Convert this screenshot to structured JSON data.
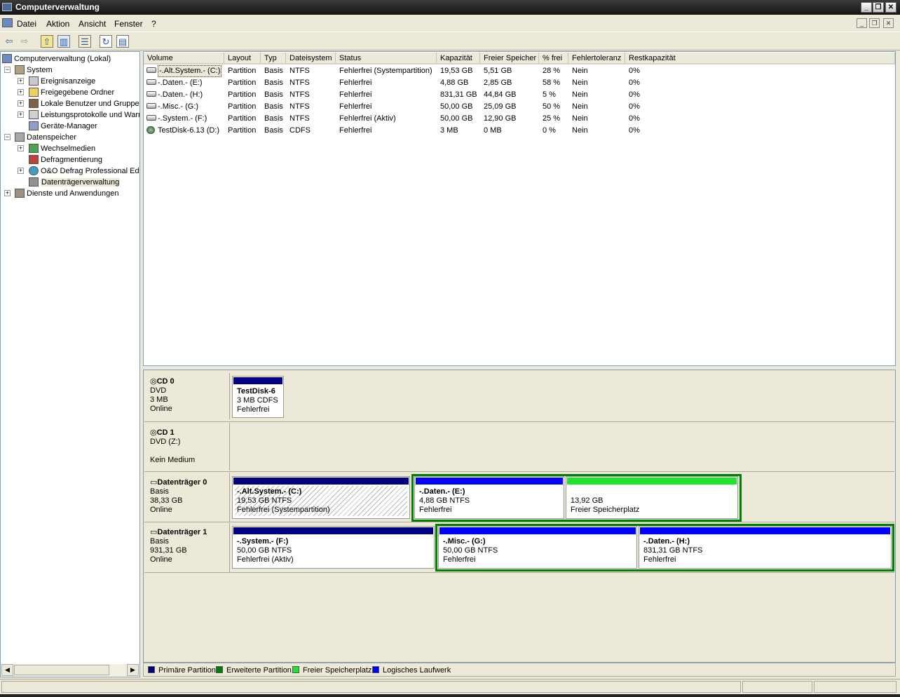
{
  "window": {
    "title": "Computerverwaltung"
  },
  "menu": [
    "Datei",
    "Aktion",
    "Ansicht",
    "Fenster",
    "?"
  ],
  "tree": {
    "root": "Computerverwaltung (Lokal)",
    "system": "System",
    "ereignis": "Ereignisanzeige",
    "freigaben": "Freigegebene Ordner",
    "benutzer": "Lokale Benutzer und Gruppen",
    "leistung": "Leistungsprotokolle und Warnungen",
    "geraete": "Geräte-Manager",
    "datenspeicher": "Datenspeicher",
    "wechsel": "Wechselmedien",
    "defrag": "Defragmentierung",
    "oodefrag": "O&O Defrag Professional Edition",
    "dtverw": "Datenträgerverwaltung",
    "dienste": "Dienste und Anwendungen"
  },
  "table": {
    "columns": [
      "Volume",
      "Layout",
      "Typ",
      "Dateisystem",
      "Status",
      "Kapazität",
      "Freier Speicher",
      "% frei",
      "Fehlertoleranz",
      "Restkapazität"
    ],
    "rows": [
      [
        "-.Alt.System.- (C:)",
        "Partition",
        "Basis",
        "NTFS",
        "Fehlerfrei (Systempartition)",
        "19,53 GB",
        "5,51 GB",
        "28 %",
        "Nein",
        "0%"
      ],
      [
        "-.Daten.- (E:)",
        "Partition",
        "Basis",
        "NTFS",
        "Fehlerfrei",
        "4,88 GB",
        "2,85 GB",
        "58 %",
        "Nein",
        "0%"
      ],
      [
        "-.Daten.- (H:)",
        "Partition",
        "Basis",
        "NTFS",
        "Fehlerfrei",
        "831,31 GB",
        "44,84 GB",
        "5 %",
        "Nein",
        "0%"
      ],
      [
        "-.Misc.- (G:)",
        "Partition",
        "Basis",
        "NTFS",
        "Fehlerfrei",
        "50,00 GB",
        "25,09 GB",
        "50 %",
        "Nein",
        "0%"
      ],
      [
        "-.System.- (F:)",
        "Partition",
        "Basis",
        "NTFS",
        "Fehlerfrei (Aktiv)",
        "50,00 GB",
        "12,90 GB",
        "25 %",
        "Nein",
        "0%"
      ],
      [
        "TestDisk-6.13 (D:)",
        "Partition",
        "Basis",
        "CDFS",
        "Fehlerfrei",
        "3 MB",
        "0 MB",
        "0 %",
        "Nein",
        "0%"
      ]
    ]
  },
  "disks": {
    "cd0": {
      "name": "CD 0",
      "type": "DVD",
      "size": "3 MB",
      "state": "Online"
    },
    "cd1": {
      "name": "CD 1",
      "type": "DVD (Z:)",
      "state": "Kein Medium"
    },
    "d0": {
      "name": "Datenträger 0",
      "type": "Basis",
      "size": "38,33 GB",
      "state": "Online"
    },
    "d1": {
      "name": "Datenträger 1",
      "type": "Basis",
      "size": "931,31 GB",
      "state": "Online"
    }
  },
  "partitions": {
    "cd0p": {
      "name": "TestDisk-6",
      "info": "3 MB CDFS",
      "status": "Fehlerfrei"
    },
    "c": {
      "name": "-.Alt.System.-  (C:)",
      "info": "19,53 GB NTFS",
      "status": "Fehlerfrei (Systempartition)"
    },
    "e": {
      "name": "-.Daten.-  (E:)",
      "info": "4,88 GB NTFS",
      "status": "Fehlerfrei"
    },
    "free": {
      "info": "13,92 GB",
      "status": "Freier Speicherplatz"
    },
    "f": {
      "name": "-.System.-  (F:)",
      "info": "50,00 GB NTFS",
      "status": "Fehlerfrei (Aktiv)"
    },
    "g": {
      "name": "-.Misc.-  (G:)",
      "info": "50,00 GB NTFS",
      "status": "Fehlerfrei"
    },
    "h": {
      "name": "-.Daten.-  (H:)",
      "info": "831,31 GB NTFS",
      "status": "Fehlerfrei"
    }
  },
  "legend": [
    "Primäre Partition",
    "Erweiterte Partition",
    "Freier Speicherplatz",
    "Logisches Laufwerk"
  ],
  "colors": {
    "primary": "#000080",
    "extended": "#008000",
    "free": "#21e32b",
    "logical": "#0000ff"
  }
}
